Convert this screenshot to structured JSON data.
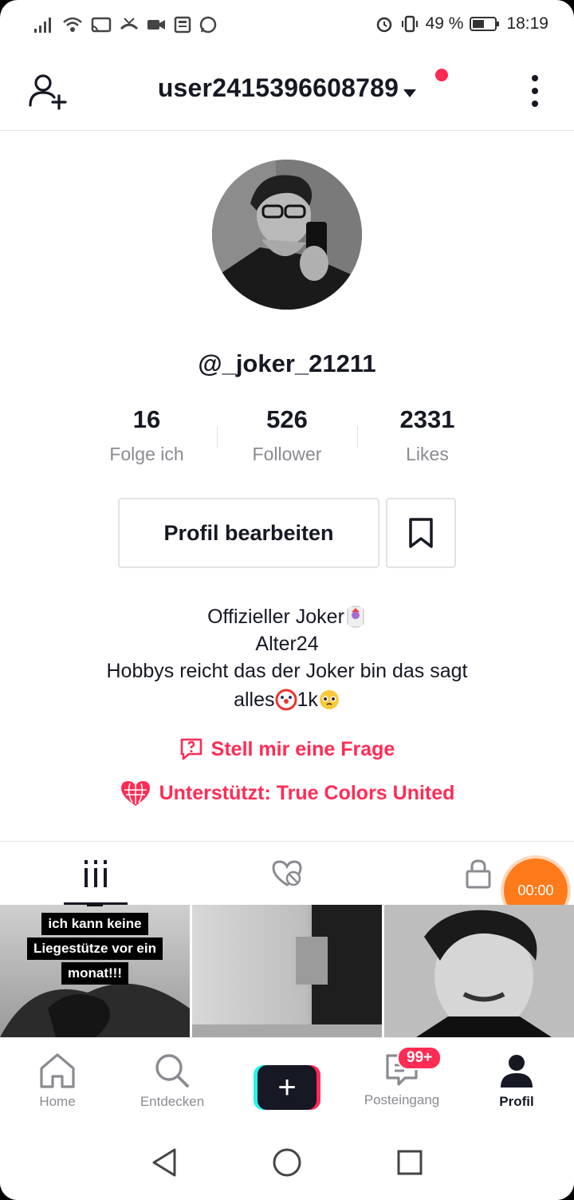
{
  "status_bar": {
    "battery_percent": "49 %",
    "time": "18:19"
  },
  "header": {
    "username": "user2415396608789"
  },
  "profile": {
    "handle": "@_joker_21211",
    "stats": [
      {
        "value": "16",
        "label": "Folge ich"
      },
      {
        "value": "526",
        "label": "Follower"
      },
      {
        "value": "2331",
        "label": "Likes"
      }
    ],
    "edit_button": "Profil bearbeiten",
    "bio": {
      "line1": "Offizieller Joker",
      "line2": "Alter24",
      "line3": "Hobbys reicht das der Joker bin das sagt",
      "line4_a": "alles",
      "line4_b": "1k"
    },
    "ask_link": "Stell mir eine Frage",
    "supports_link": "Unterstützt: True Colors United"
  },
  "recorder": {
    "time": "00:00"
  },
  "videos": [
    {
      "caption": [
        "ich kann keine",
        "Liegestütze vor ein",
        "monat!!!"
      ]
    },
    {
      "caption": []
    },
    {
      "caption": []
    }
  ],
  "bottom_nav": {
    "home": "Home",
    "discover": "Entdecken",
    "inbox": "Posteingang",
    "inbox_badge": "99+",
    "profile": "Profil"
  },
  "colors": {
    "accent": "#fe2c55",
    "cyan": "#25f4ee",
    "text": "#161823",
    "muted": "#8a8b91",
    "recorder": "#ff7a1a"
  }
}
